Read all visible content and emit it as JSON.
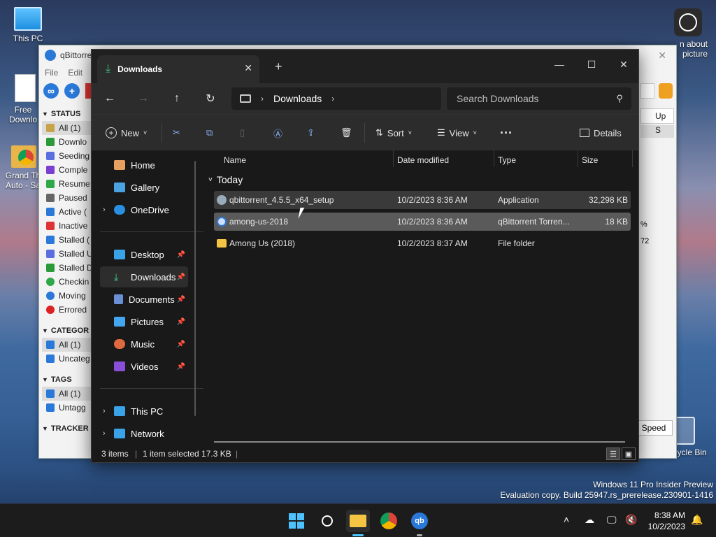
{
  "desktop": {
    "icons": [
      {
        "name": "This PC"
      },
      {
        "name": "Free Downlo"
      },
      {
        "name": "Grand Th Auto - Sa"
      },
      {
        "name": "Recycle Bin"
      }
    ],
    "partial_text": "n about picture"
  },
  "qbittorrent": {
    "title": "qBittorre",
    "menu": [
      "File",
      "Edit"
    ],
    "status_header": "STATUS",
    "status_items": [
      "All (1)",
      "Downlo",
      "Seeding",
      "Comple",
      "Resume",
      "Paused",
      "Active (",
      "Inactive",
      "Stalled (",
      "Stalled U",
      "Stalled D",
      "Checkin",
      "Moving",
      "Errored"
    ],
    "categories_header": "CATEGOR",
    "category_items": [
      "All (1)",
      "Uncateg"
    ],
    "tags_header": "TAGS",
    "tag_items": [
      "All (1)",
      "Untagg"
    ],
    "trackers_header": "TRACKER",
    "right_header": "Up S",
    "right_vals": [
      "%",
      "72"
    ],
    "speed_btn": "Speed"
  },
  "explorer": {
    "tab_title": "Downloads",
    "address": {
      "root_icon": "monitor-icon",
      "crumb": "Downloads"
    },
    "search_placeholder": "Search Downloads",
    "commands": {
      "new": "New",
      "sort": "Sort",
      "view": "View",
      "details": "Details"
    },
    "nav": {
      "home": "Home",
      "gallery": "Gallery",
      "onedrive": "OneDrive",
      "desktop": "Desktop",
      "downloads": "Downloads",
      "documents": "Documents",
      "pictures": "Pictures",
      "music": "Music",
      "videos": "Videos",
      "thispc": "This PC",
      "network": "Network"
    },
    "columns": {
      "name": "Name",
      "date": "Date modified",
      "type": "Type",
      "size": "Size"
    },
    "group": "Today",
    "files": [
      {
        "name": "qbittorrent_4.5.5_x64_setup",
        "date": "10/2/2023 8:36 AM",
        "type": "Application",
        "size": "32,298 KB"
      },
      {
        "name": "among-us-2018",
        "date": "10/2/2023 8:36 AM",
        "type": "qBittorrent Torren...",
        "size": "18 KB"
      },
      {
        "name": "Among Us (2018)",
        "date": "10/2/2023 8:37 AM",
        "type": "File folder",
        "size": ""
      }
    ],
    "status": {
      "count": "3 items",
      "selected": "1 item selected  17.3 KB"
    }
  },
  "windows_version": {
    "line1": "Windows 11 Pro Insider Preview",
    "line2": "Evaluation copy. Build 25947.rs_prerelease.230901-1416"
  },
  "taskbar": {
    "time": "8:38 AM",
    "date": "10/2/2023"
  },
  "colors": {
    "accent": "#4cc2ff",
    "qb_blue": "#2a79d8",
    "folder": "#f4c542"
  }
}
